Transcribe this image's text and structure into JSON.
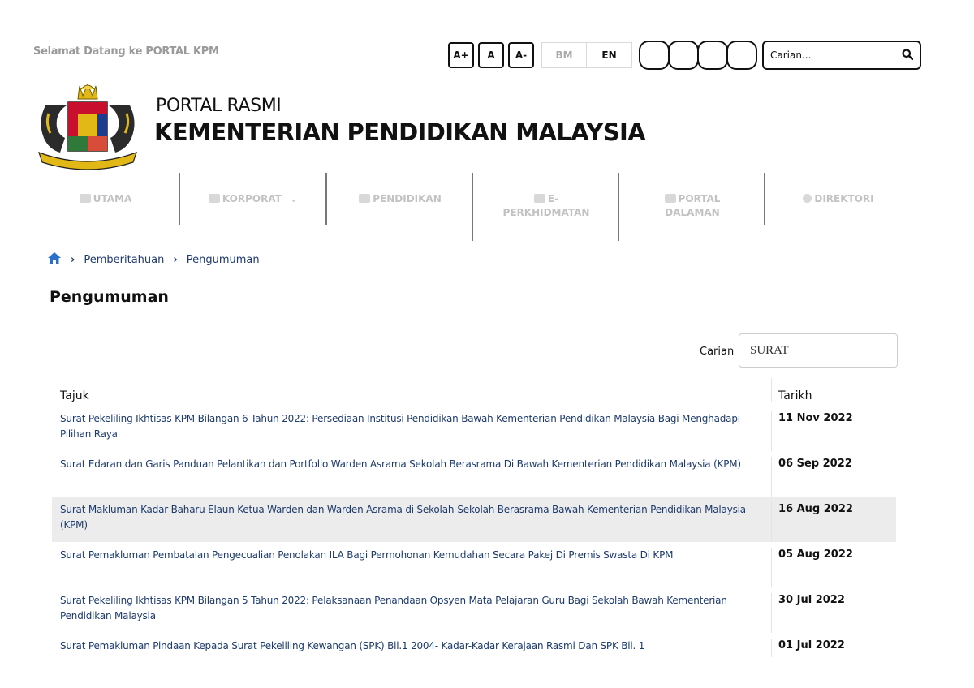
{
  "header": {
    "welcome": "Selamat Datang ke PORTAL KPM",
    "font_controls": [
      "A+",
      "A",
      "A-"
    ],
    "languages": [
      "BM",
      "EN"
    ],
    "search_placeholder": "Carian..."
  },
  "brand": {
    "line1": "PORTAL RASMI",
    "line2": "KEMENTERIAN PENDIDIKAN MALAYSIA"
  },
  "nav": [
    {
      "label": "UTAMA",
      "icon": "home-icon"
    },
    {
      "label": "KORPORAT",
      "icon": "user-icon",
      "dropdown": "⌄"
    },
    {
      "label": "PENDIDIKAN",
      "icon": "book-icon"
    },
    {
      "label": "E-PERKHIDMATAN",
      "line1": "E-",
      "line2": "PERKHIDMATAN",
      "icon": "gears-icon"
    },
    {
      "label": "PORTAL DALAMAN",
      "line1": "PORTAL",
      "line2": "DALAMAN",
      "icon": "window-icon"
    },
    {
      "label": "DIREKTORI",
      "icon": "globe-icon"
    }
  ],
  "breadcrumb": [
    "Pemberitahuan",
    "Pengumuman"
  ],
  "page": {
    "title": "Pengumuman",
    "filter_label": "Carian",
    "filter_value": "SURAT"
  },
  "table": {
    "headers": [
      "Tajuk",
      "Tarikh"
    ],
    "rows": [
      {
        "title": "Surat Pekeliling Ikhtisas KPM Bilangan 6 Tahun 2022: Persediaan Institusi Pendidikan Bawah Kementerian Pendidikan Malaysia Bagi Menghadapi Pilihan Raya",
        "date": "11 Nov 2022"
      },
      {
        "title": "Surat Edaran dan Garis Panduan Pelantikan dan Portfolio Warden Asrama Sekolah Berasrama Di Bawah Kementerian Pendidikan Malaysia (KPM)",
        "date": "06 Sep 2022"
      },
      {
        "title": "Surat Makluman Kadar Baharu Elaun Ketua Warden dan Warden Asrama di Sekolah-Sekolah Berasrama Bawah Kementerian Pendidikan Malaysia (KPM)",
        "date": "16 Aug 2022"
      },
      {
        "title": "Surat Pemakluman Pembatalan Pengecualian Penolakan ILA Bagi Permohonan Kemudahan Secara Pakej Di Premis Swasta Di KPM",
        "date": "05 Aug 2022"
      },
      {
        "title": "Surat Pekeliling Ikhtisas KPM Bilangan 5 Tahun 2022: Pelaksanaan Penandaan Opsyen Mata Pelajaran Guru Bagi Sekolah Bawah Kementerian Pendidikan Malaysia",
        "date": "30 Jul 2022"
      },
      {
        "title": "Surat Pemakluman Pindaan Kepada Surat Pekeliling Kewangan (SPK) Bil.1 2004- Kadar-Kadar Kerajaan Rasmi Dan SPK Bil. 1",
        "date": "01 Jul 2022"
      }
    ]
  }
}
